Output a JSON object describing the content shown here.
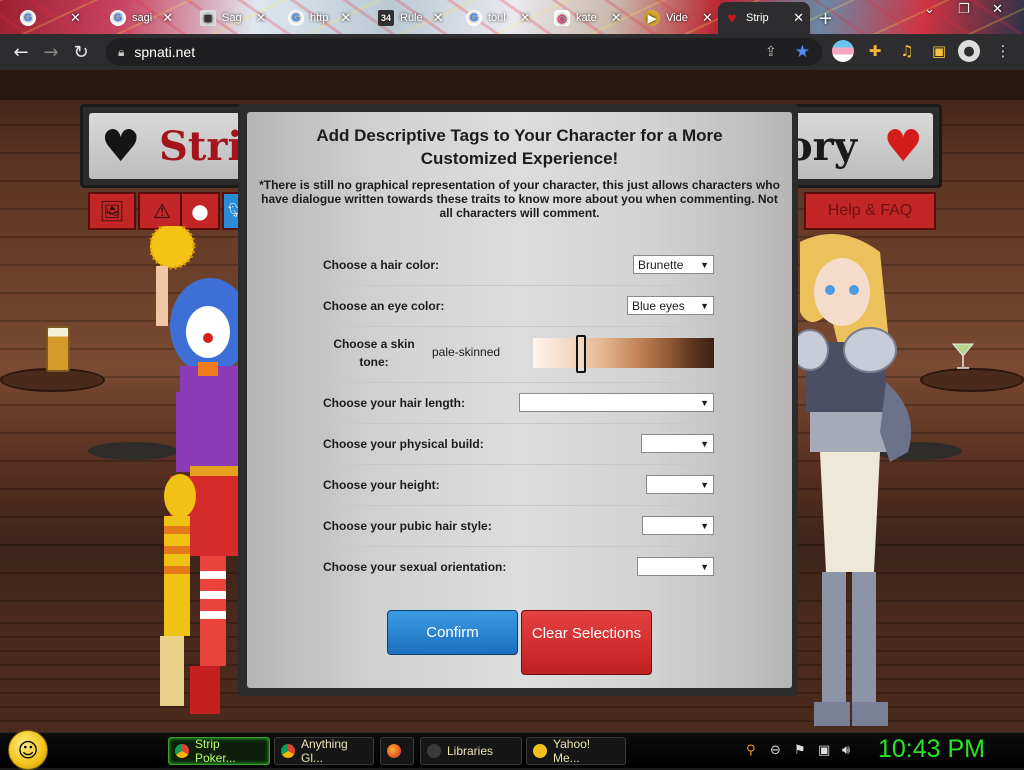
{
  "browser": {
    "tabs": [
      {
        "label": "",
        "icon": "google-icon"
      },
      {
        "label": "sagi",
        "icon": "google-icon"
      },
      {
        "label": "Sag",
        "icon": "page-icon"
      },
      {
        "label": "http",
        "icon": "google-icon"
      },
      {
        "label": "Rule",
        "icon": "rule34-icon",
        "badge": "34"
      },
      {
        "label": "toul",
        "icon": "google-icon"
      },
      {
        "label": "kate",
        "icon": "instagram-icon"
      },
      {
        "label": "Vide",
        "icon": "video-icon"
      },
      {
        "label": "Strip",
        "icon": "heart-icon",
        "active": true
      }
    ],
    "new_tab": "+",
    "url": "spnati.net"
  },
  "site": {
    "title_left": "Strip",
    "title_right": "ory",
    "help_button": "Help & FAQ"
  },
  "modal": {
    "heading": "Add Descriptive Tags to Your Character for a More Customized Experience!",
    "note": "*There is still no graphical representation of your character, this just allows characters who have dialogue written towards these traits to know more about you when commenting. Not all characters will comment.",
    "hair_color": {
      "label": "Choose a hair color:",
      "value": "Brunette"
    },
    "eye_color": {
      "label": "Choose an eye color:",
      "value": "Blue eyes"
    },
    "skin_tone": {
      "label": "Choose a skin tone:",
      "value": "pale-skinned",
      "level": 0.25
    },
    "hair_length": {
      "label": "Choose your hair length:",
      "value": ""
    },
    "physical_build": {
      "label": "Choose your physical build:",
      "value": ""
    },
    "height": {
      "label": "Choose your height:",
      "value": ""
    },
    "pubic_hair": {
      "label": "Choose your pubic hair style:",
      "value": ""
    },
    "orientation": {
      "label": "Choose your sexual orientation:",
      "value": ""
    },
    "confirm": "Confirm",
    "clear": "Clear Selections"
  },
  "taskbar": {
    "items": [
      {
        "label": "Strip Poker...",
        "icon": "chrome-icon",
        "active": true
      },
      {
        "label": "Anything Gl...",
        "icon": "chrome-icon"
      },
      {
        "label": "",
        "icon": "firefox-icon"
      },
      {
        "label": "Libraries",
        "icon": "folder-icon"
      },
      {
        "label": "Yahoo! Me...",
        "icon": "yahoo-messenger-icon"
      }
    ],
    "clock": "10:43 PM"
  },
  "colors": {
    "accent_blue": "#1c6fc0",
    "accent_red": "#bf2020",
    "clock_green": "#25e625"
  }
}
